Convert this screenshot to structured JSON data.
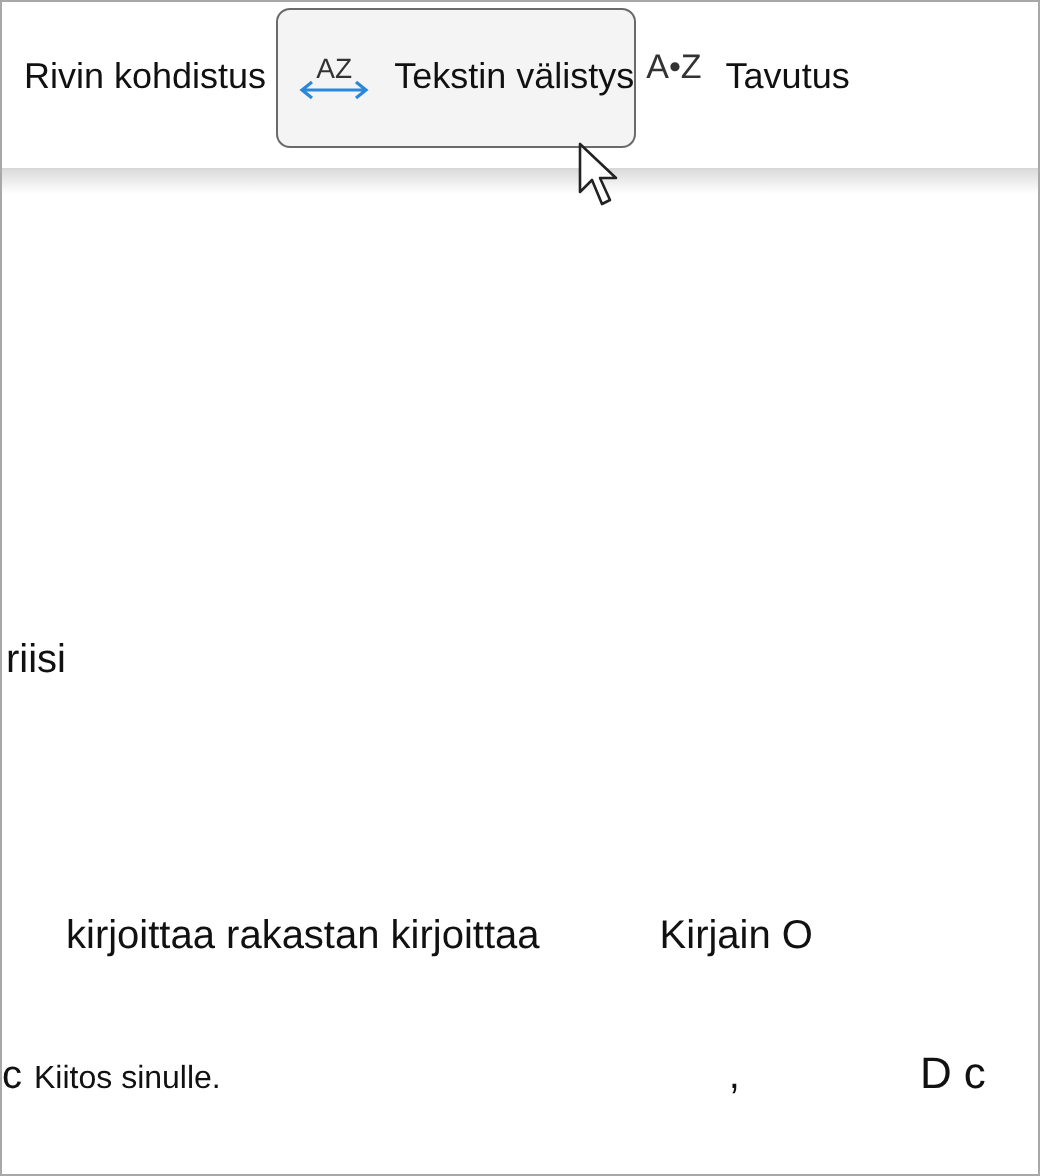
{
  "toolbar": {
    "buttons": [
      {
        "label": "Rivin kohdistus",
        "highlighted": false
      },
      {
        "label": "Tekstin välistys",
        "icon_text": "AZ",
        "kind": "spacing",
        "highlighted": true
      },
      {
        "label": "Tavutus",
        "icon_text": "A•Z",
        "kind": "hyphen",
        "highlighted": false
      }
    ]
  },
  "document": {
    "lines": [
      {
        "kind": "single",
        "texts": [
          "riisi"
        ]
      },
      {
        "kind": "pair",
        "texts": [
          "kirjoittaa rakastan kirjoittaa",
          "Kirjain O"
        ]
      },
      {
        "kind": "footer",
        "texts": [
          "c",
          "Kiitos sinulle.",
          ",",
          "D",
          "c"
        ]
      }
    ]
  }
}
